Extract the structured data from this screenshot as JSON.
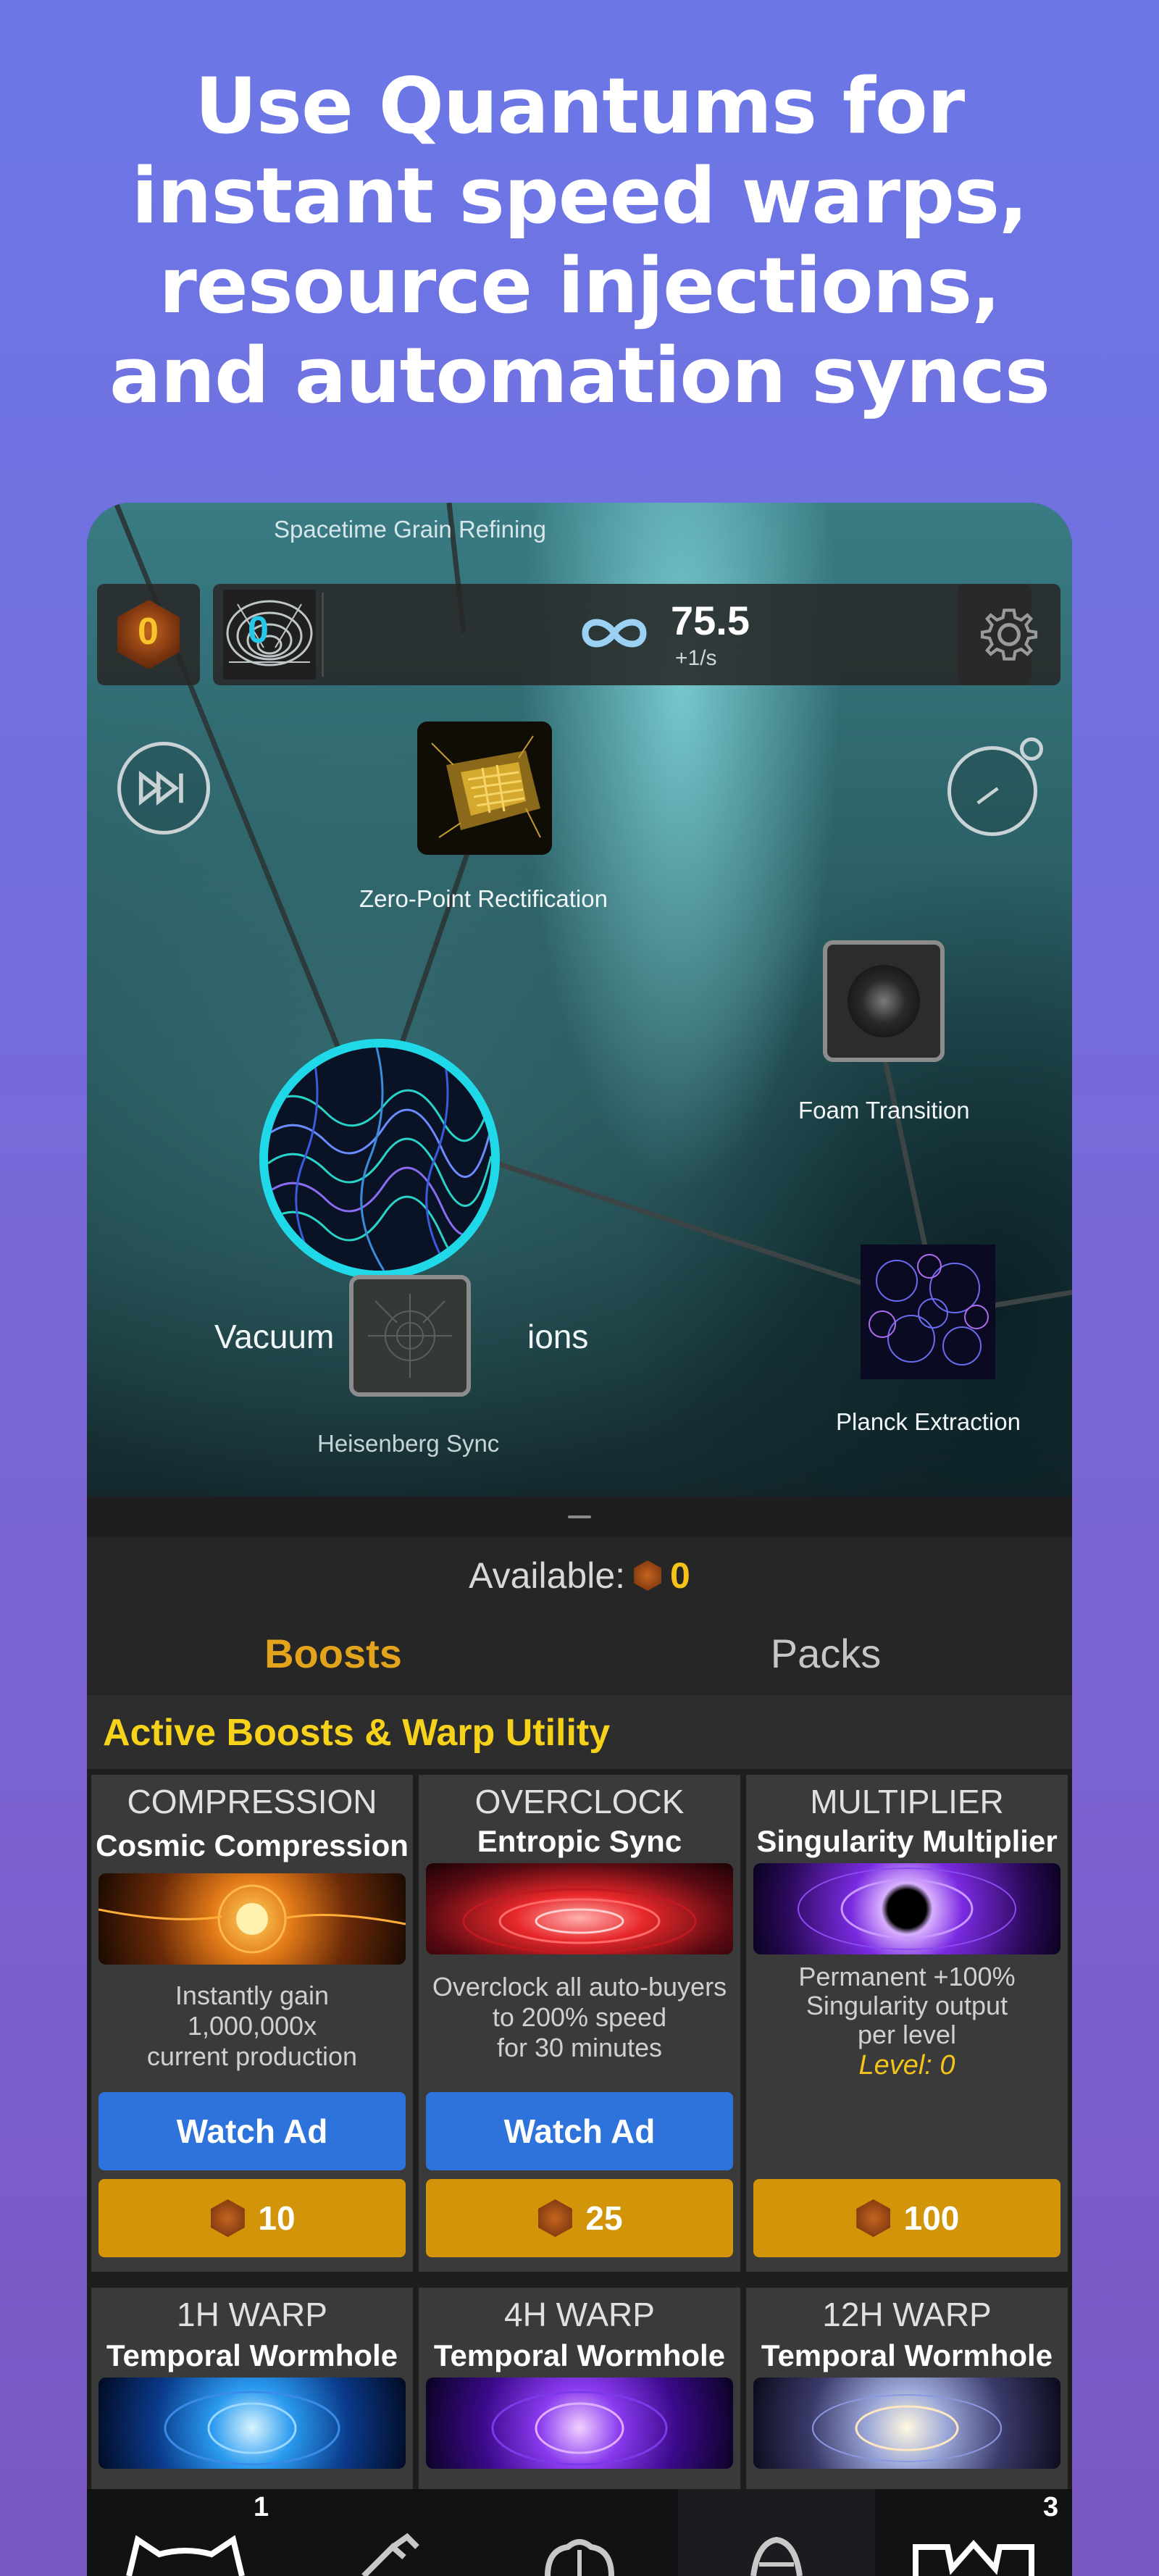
{
  "headline": {
    "line1": "Use Quantums for",
    "line2": "instant speed warps,",
    "line3": "resource injections,",
    "line4": "and automation syncs"
  },
  "game": {
    "top_caption": "Spacetime Grain Refining",
    "quantum_count": "0",
    "warp_count": "0",
    "score": "75.5",
    "rate": "+1/s",
    "nodes": {
      "zero_point": "Zero-Point Rectification",
      "foam": "Foam Transition",
      "vacuum": "Vacuum",
      "vacuum_suffix": "ions",
      "heisenberg": "Heisenberg Sync",
      "planck": "Planck Extraction"
    }
  },
  "available": {
    "label": "Available:",
    "value": "0"
  },
  "tabs": {
    "boosts": "Boosts",
    "packs": "Packs"
  },
  "section_title": "Active Boosts & Warp Utility",
  "cards": [
    {
      "category": "COMPRESSION",
      "name": "Cosmic Compression",
      "desc1": "Instantly gain",
      "desc2": "1,000,000x",
      "desc3": "current production",
      "ad_label": "Watch Ad",
      "cost": "10"
    },
    {
      "category": "OVERCLOCK",
      "name": "Entropic Sync",
      "desc1": "Overclock all auto-buyers",
      "desc2": "to 200% speed",
      "desc3": "for 30 minutes",
      "ad_label": "Watch Ad",
      "cost": "25"
    },
    {
      "category": "MULTIPLIER",
      "name": "Singularity Multiplier",
      "desc1": "Permanent +100%",
      "desc2": "Singularity output",
      "desc3": "per level",
      "level": "Level: 0",
      "cost": "100"
    },
    {
      "category": "1H WARP",
      "name": "Temporal Wormhole"
    },
    {
      "category": "4H WARP",
      "name": "Temporal Wormhole"
    },
    {
      "category": "12H WARP",
      "name": "Temporal Wormhole"
    }
  ],
  "bottom_nav": {
    "badge1": "1",
    "badge5": "3",
    "icons": [
      "cat-icon",
      "flask-icon",
      "brain-icon",
      "egg-icon",
      "trophy-icon"
    ]
  },
  "colors": {
    "accent_gold": "#e3a41c",
    "title_yellow": "#f7d21b",
    "ad_blue": "#2e73db",
    "cost_orange": "#d29408",
    "cyan_ring": "#1fd8e8"
  }
}
